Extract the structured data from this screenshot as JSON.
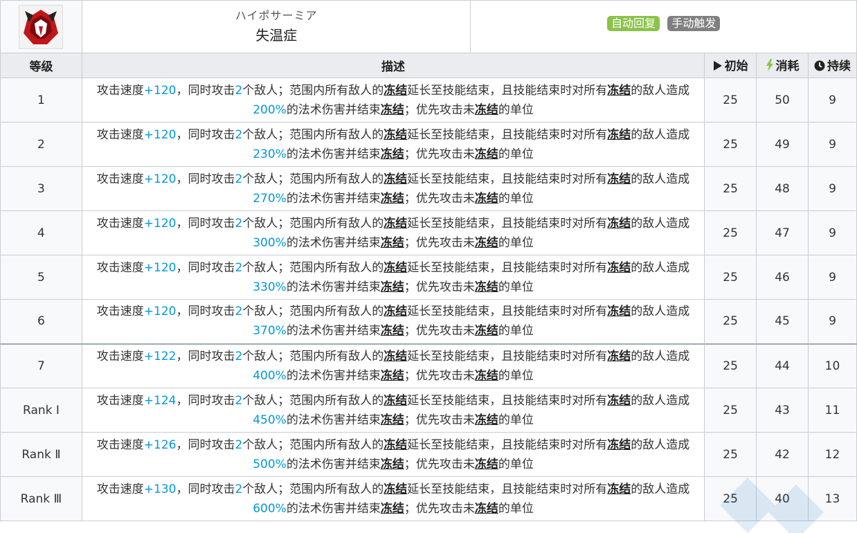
{
  "skill": {
    "name_jp": "ハイポサーミア",
    "name_cn": "失温症",
    "tags": [
      {
        "label": "自动回复",
        "color": "#8bc34a"
      },
      {
        "label": "手动触发",
        "color": "#808080"
      }
    ]
  },
  "columns": {
    "level": "等级",
    "desc": "描述",
    "init": "初始",
    "cost": "消耗",
    "duration": "持续"
  },
  "desc_parts": {
    "p1": "攻击速度",
    "p2": "，同时攻击",
    "p3": "2",
    "p4": "个敌人；范围内所有敌人的",
    "kw": "冻结",
    "p5": "延长至技能结束，且技能结束时对所有",
    "p6": "的敌人造成",
    "p7": "的法术伤害并结束",
    "p8": "；优先攻击未",
    "p9": "的单位"
  },
  "rows": [
    {
      "level": "1",
      "atk": "+120",
      "dmg": "200%",
      "init": "25",
      "cost": "50",
      "duration": "9"
    },
    {
      "level": "2",
      "atk": "+120",
      "dmg": "230%",
      "init": "25",
      "cost": "49",
      "duration": "9"
    },
    {
      "level": "3",
      "atk": "+120",
      "dmg": "270%",
      "init": "25",
      "cost": "48",
      "duration": "9"
    },
    {
      "level": "4",
      "atk": "+120",
      "dmg": "300%",
      "init": "25",
      "cost": "47",
      "duration": "9"
    },
    {
      "level": "5",
      "atk": "+120",
      "dmg": "330%",
      "init": "25",
      "cost": "46",
      "duration": "9"
    },
    {
      "level": "6",
      "atk": "+120",
      "dmg": "370%",
      "init": "25",
      "cost": "45",
      "duration": "9"
    },
    {
      "level": "7",
      "atk": "+122",
      "dmg": "400%",
      "init": "25",
      "cost": "44",
      "duration": "10"
    },
    {
      "level": "Rank Ⅰ",
      "atk": "+124",
      "dmg": "450%",
      "init": "25",
      "cost": "43",
      "duration": "11"
    },
    {
      "level": "Rank Ⅱ",
      "atk": "+126",
      "dmg": "500%",
      "init": "25",
      "cost": "42",
      "duration": "12"
    },
    {
      "level": "Rank Ⅲ",
      "atk": "+130",
      "dmg": "600%",
      "init": "25",
      "cost": "40",
      "duration": "13"
    }
  ],
  "colors": {
    "highlight": "#0098dc",
    "sp_green": "#8bc34a",
    "header_bg": "#eaecf0"
  }
}
